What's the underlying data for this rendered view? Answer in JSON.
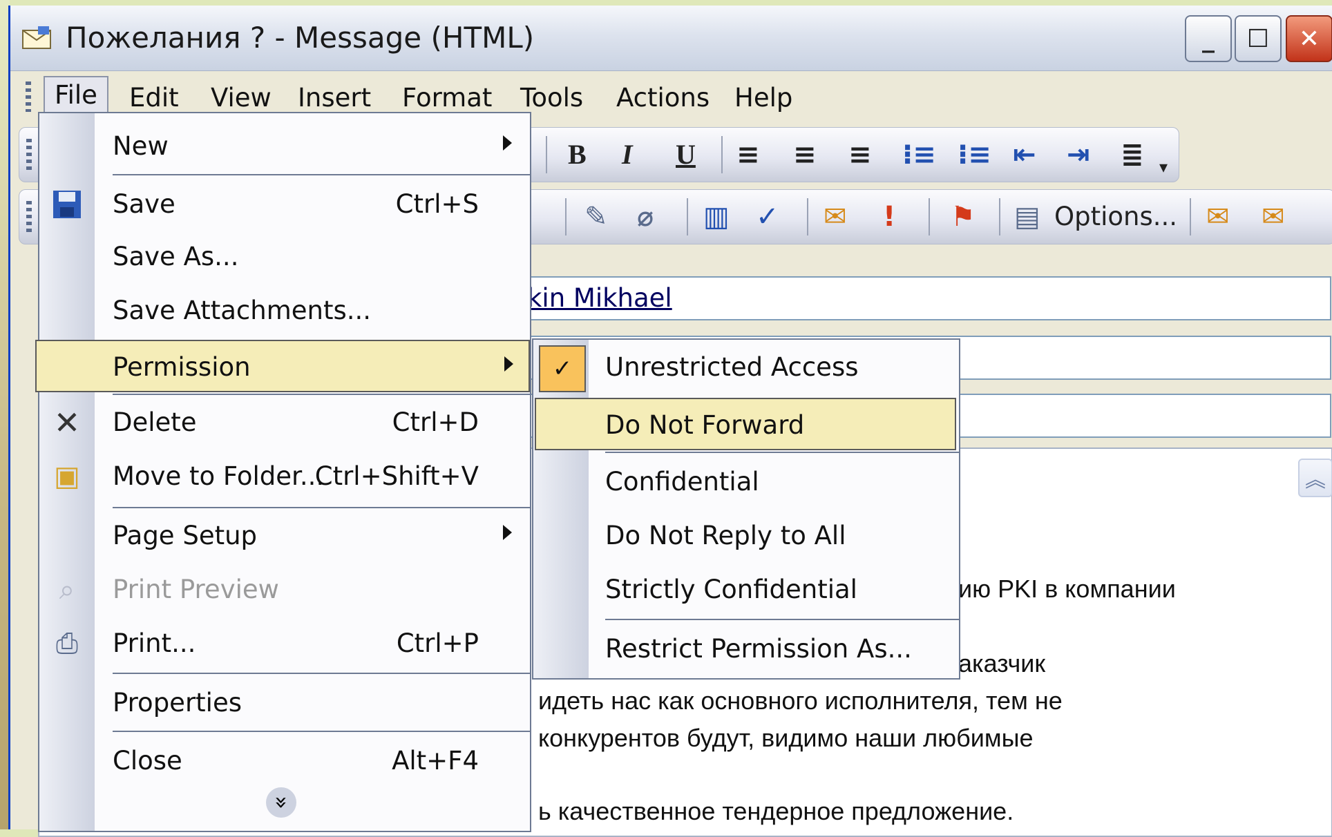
{
  "window": {
    "title": "Пожелания ? - Message (HTML)",
    "caption_minimize": "_",
    "caption_maximize": "☐",
    "caption_close": "✕"
  },
  "menubar": {
    "items": [
      {
        "label": "File",
        "active": true
      },
      {
        "label": "Edit"
      },
      {
        "label": "View"
      },
      {
        "label": "Insert"
      },
      {
        "label": "Format"
      },
      {
        "label": "Tools"
      },
      {
        "label": "Actions"
      },
      {
        "label": "Help"
      }
    ]
  },
  "format_toolbar": {
    "bold": "B",
    "italic": "I",
    "underline": "U"
  },
  "standard_toolbar": {
    "options_label": "Options..."
  },
  "message": {
    "to_partial": "kin Mikhael",
    "body_lines": [
      "ию PKI в компании",
      "аказчик",
      "идеть нас как основного исполнителя, тем не",
      "конкурентов будут, видимо наши любимые",
      "ь качественное тендерное предложение."
    ]
  },
  "file_menu": {
    "items": [
      {
        "label": "New",
        "shortcut": "",
        "submenu": true
      },
      {
        "label": "Save",
        "shortcut": "Ctrl+S"
      },
      {
        "label": "Save As..."
      },
      {
        "label": "Save Attachments..."
      },
      {
        "label": "Permission",
        "submenu": true,
        "highlighted": true
      },
      {
        "label": "Delete",
        "shortcut": "Ctrl+D"
      },
      {
        "label": "Move to Folder...",
        "shortcut": "Ctrl+Shift+V"
      },
      {
        "label": "Page Setup",
        "submenu": true
      },
      {
        "label": "Print Preview",
        "disabled": true
      },
      {
        "label": "Print...",
        "shortcut": "Ctrl+P"
      },
      {
        "label": "Properties"
      },
      {
        "label": "Close",
        "shortcut": "Alt+F4"
      }
    ],
    "expand_glyph": "»"
  },
  "permission_menu": {
    "items": [
      {
        "label": "Unrestricted Access",
        "checked": true
      },
      {
        "label": "Do Not Forward",
        "highlighted": true
      },
      {
        "label": "Confidential"
      },
      {
        "label": "Do Not Reply to All"
      },
      {
        "label": "Strictly Confidential"
      },
      {
        "label": "Restrict Permission As..."
      }
    ],
    "check_glyph": "✓"
  },
  "colors": {
    "menu_highlight": "#f5edb8",
    "checked_bg": "#f9c25c",
    "window_border": "#0a3fc4"
  }
}
